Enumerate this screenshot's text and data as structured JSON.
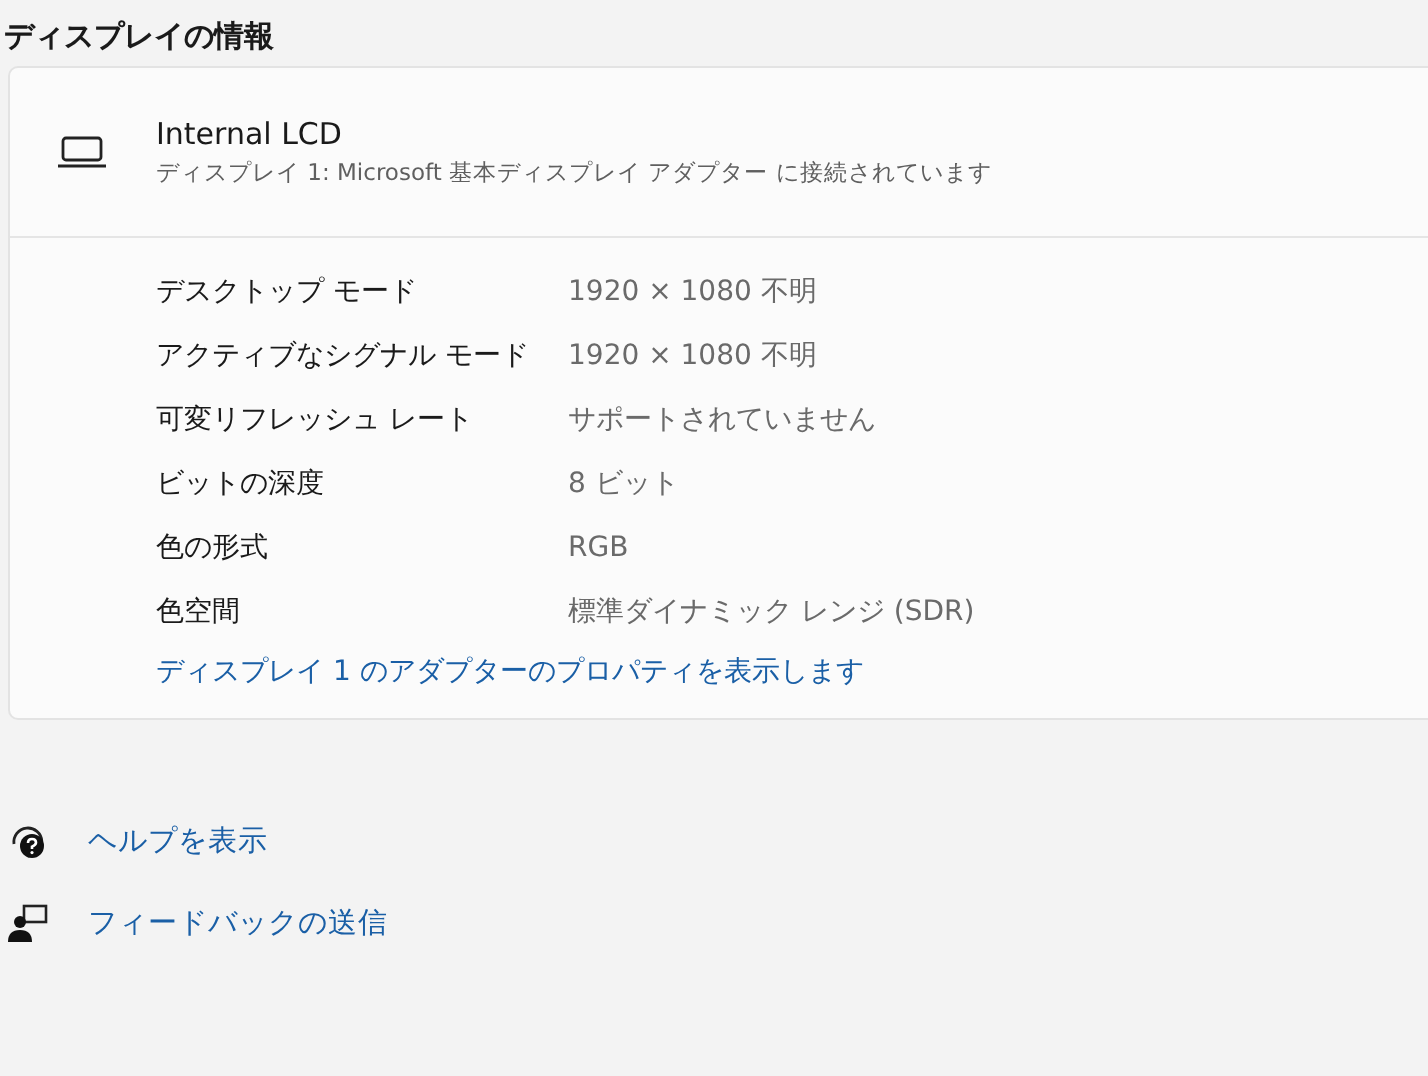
{
  "section_title": "ディスプレイの情報",
  "display": {
    "name": "Internal LCD",
    "description": "ディスプレイ 1: Microsoft 基本ディスプレイ アダプター に接続されています"
  },
  "properties": [
    {
      "label": "デスクトップ モード",
      "value": "1920 × 1080 不明"
    },
    {
      "label": "アクティブなシグナル モード",
      "value": "1920 × 1080 不明"
    },
    {
      "label": "可変リフレッシュ レート",
      "value": "サポートされていません"
    },
    {
      "label": "ビットの深度",
      "value": "8 ビット"
    },
    {
      "label": "色の形式",
      "value": "RGB"
    },
    {
      "label": "色空間",
      "value": "標準ダイナミック レンジ (SDR)"
    }
  ],
  "adapter_link": "ディスプレイ 1 のアダプターのプロパティを表示します",
  "footer_links": [
    {
      "kind": "help",
      "label": "ヘルプを表示"
    },
    {
      "kind": "feedback",
      "label": "フィードバックの送信"
    }
  ]
}
